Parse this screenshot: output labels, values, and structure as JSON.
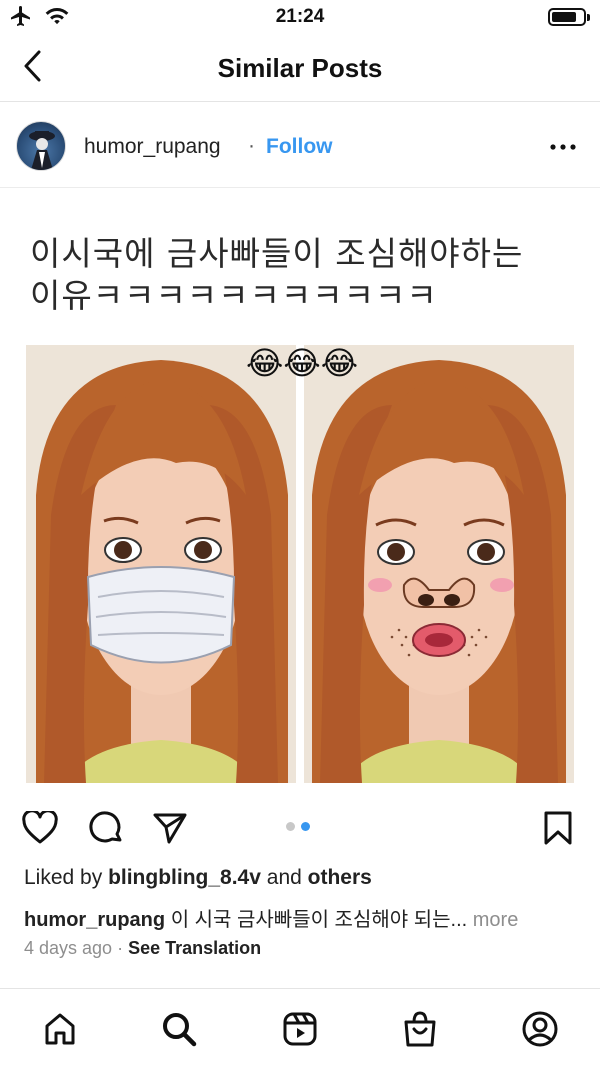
{
  "status_bar": {
    "time": "21:24",
    "icons": [
      "airplane-icon",
      "wifi-icon",
      "battery-icon"
    ],
    "battery_level": 0.8
  },
  "nav": {
    "title": "Similar Posts",
    "back_icon": "chevron-left-icon"
  },
  "post": {
    "username": "humor_rupang",
    "separator": "·",
    "follow_label": "Follow",
    "more_icon": "ellipsis-icon",
    "image": {
      "caption_line1": "이시국에  금사빠들이  조심해야하는",
      "caption_line2": "이유ㅋㅋㅋㅋㅋㅋㅋㅋㅋㅋㅋ",
      "emojis": "😂😂😂"
    },
    "carousel": {
      "count": 2,
      "active_index": 1
    },
    "likes": {
      "prefix": "Liked by",
      "user": "blingbling_8.4v",
      "middle": "and",
      "others": "others"
    },
    "caption": {
      "user": "humor_rupang",
      "text": "이 시국 금사빠들이 조심해야 되는...",
      "more": "more"
    },
    "time_ago": "4 days ago",
    "meta_separator": "·",
    "see_translation": "See Translation"
  },
  "tab_bar": {
    "items": [
      "home-icon",
      "search-icon",
      "reels-icon",
      "shop-icon",
      "profile-icon"
    ]
  },
  "colors": {
    "accent": "#3897f0",
    "text": "#222222",
    "muted": "#8e8e8e"
  }
}
